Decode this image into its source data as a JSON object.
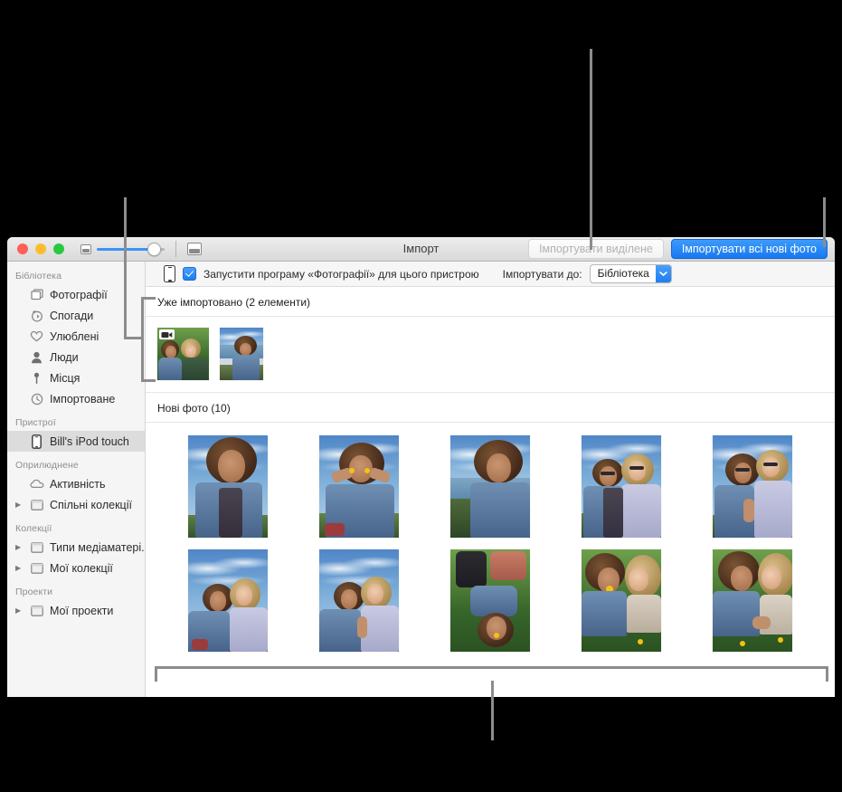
{
  "window": {
    "title": "Імпорт",
    "traffic_lights": [
      "close",
      "minimize",
      "zoom"
    ],
    "zoom_slider": {
      "small_icon": "small-photo-icon",
      "large_icon": "large-photo-icon",
      "value_percent": 75
    },
    "toolbar": {
      "import_selected_label": "Імпортувати виділене",
      "import_selected_disabled": true,
      "import_all_new_label": "Імпортувати всі нові фото",
      "accent_color": "#1878f0"
    }
  },
  "option_bar": {
    "device_icon": "ipod-touch-icon",
    "checkbox_checked": true,
    "checkbox_label": "Запустити програму «Фотографії» для цього пристрою",
    "import_to_label": "Імпортувати до:",
    "import_to_value": "Бібліотека"
  },
  "sidebar": {
    "groups": [
      {
        "title": "Бібліотека",
        "items": [
          {
            "label": "Фотографії",
            "icon": "photos-icon",
            "disclosure": false,
            "selected": false
          },
          {
            "label": "Спогади",
            "icon": "memories-icon",
            "disclosure": false,
            "selected": false
          },
          {
            "label": "Улюблені",
            "icon": "heart-icon",
            "disclosure": false,
            "selected": false
          },
          {
            "label": "Люди",
            "icon": "person-icon",
            "disclosure": false,
            "selected": false
          },
          {
            "label": "Місця",
            "icon": "pin-icon",
            "disclosure": false,
            "selected": false
          },
          {
            "label": "Імпортоване",
            "icon": "clock-icon",
            "disclosure": false,
            "selected": false
          }
        ]
      },
      {
        "title": "Пристрої",
        "items": [
          {
            "label": "Bill's iPod touch",
            "icon": "ipod-touch-icon",
            "disclosure": false,
            "selected": true
          }
        ]
      },
      {
        "title": "Оприлюднене",
        "items": [
          {
            "label": "Активність",
            "icon": "cloud-icon",
            "disclosure": false,
            "selected": false
          },
          {
            "label": "Спільні колекції",
            "icon": "album-icon",
            "disclosure": true,
            "selected": false
          }
        ]
      },
      {
        "title": "Колекції",
        "items": [
          {
            "label": "Типи медіаматері...",
            "icon": "album-icon",
            "disclosure": true,
            "selected": false
          },
          {
            "label": "Мої колекції",
            "icon": "album-icon",
            "disclosure": true,
            "selected": false
          }
        ]
      },
      {
        "title": "Проекти",
        "items": [
          {
            "label": "Мої проекти",
            "icon": "album-icon",
            "disclosure": true,
            "selected": false
          }
        ]
      }
    ]
  },
  "content": {
    "already_imported": {
      "heading": "Уже імпортовано (2 елементи)",
      "count": 2,
      "items": [
        {
          "scene": "two-girls-lying-grass",
          "is_video": true,
          "orientation": "landscape"
        },
        {
          "scene": "girl-afro-by-sea",
          "is_video": false,
          "orientation": "portrait"
        }
      ]
    },
    "new_photos": {
      "heading": "Нові фото (10)",
      "count": 10,
      "items": [
        {
          "scene": "girl-afro-looking-up-sky"
        },
        {
          "scene": "girl-flowers-over-eyes"
        },
        {
          "scene": "girl-afro-smiling-coast"
        },
        {
          "scene": "two-girls-sunglasses-hug"
        },
        {
          "scene": "two-girls-sunglasses-peace"
        },
        {
          "scene": "two-girls-selfie-sky"
        },
        {
          "scene": "two-girls-peace-sign-sky"
        },
        {
          "scene": "girls-lying-grass-overhead"
        },
        {
          "scene": "two-girls-grass-flower-mouth"
        },
        {
          "scene": "two-girls-grass-smiling"
        }
      ]
    }
  },
  "callouts": {
    "line_color": "#8c8c8c",
    "markers": [
      {
        "name": "sidebar-callout",
        "target": "already-imported-section"
      },
      {
        "name": "import-selected-callout",
        "target": "import-selected-button"
      },
      {
        "name": "import-all-callout",
        "target": "import-all-new-button"
      },
      {
        "name": "new-photos-callout",
        "target": "new-photos-grid"
      }
    ]
  }
}
